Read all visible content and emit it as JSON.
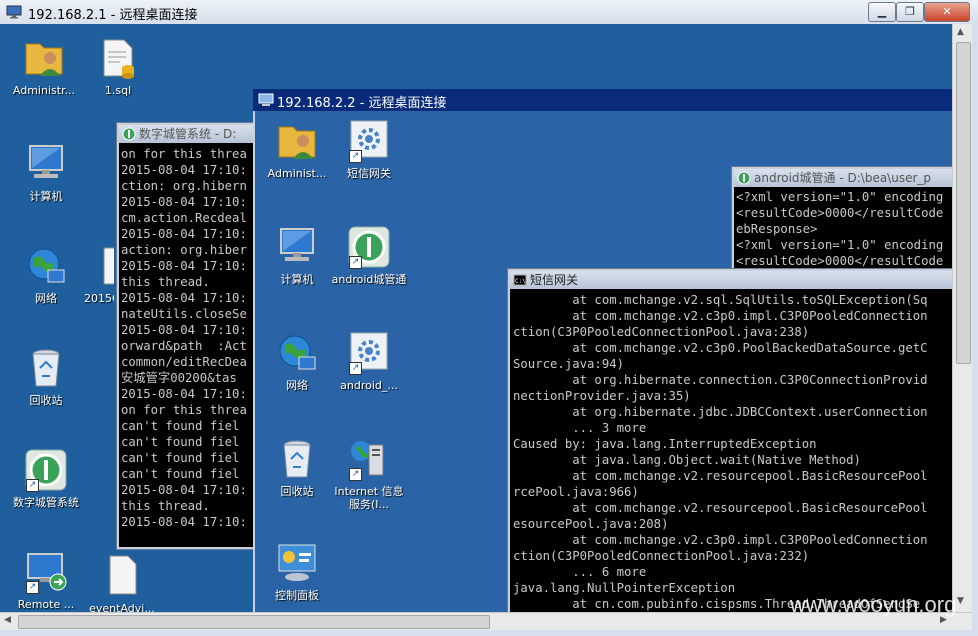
{
  "outer_window": {
    "title": "192.168.2.1 - 远程桌面连接",
    "minimize_label": "▁",
    "restore_label": "❐",
    "close_label": "✕"
  },
  "desktop1_icons": [
    {
      "label": "Administr...",
      "icon": "user-folder-icon"
    },
    {
      "label": "1.sql",
      "icon": "sql-file-icon"
    },
    {
      "label": "计算机",
      "icon": "computer-icon"
    },
    {
      "label": "网络",
      "icon": "network-icon"
    },
    {
      "label": "2015C",
      "icon": "file-icon"
    },
    {
      "label": "回收站",
      "icon": "recycle-bin-icon"
    },
    {
      "label": "数字城管系统",
      "icon": "app-shortcut-icon"
    },
    {
      "label": "Remote ...",
      "icon": "remote-desktop-icon"
    },
    {
      "label": "eventAdvi...",
      "icon": "file-icon"
    }
  ],
  "console_city": {
    "title": "数字城管系统 - D:",
    "lines": [
      "on for this threa",
      "2015-08-04 17:10:",
      "ction: org.hibern",
      "2015-08-04 17:10:",
      "cm.action.Recdeal",
      "2015-08-04 17:10:",
      "action: org.hiber",
      "2015-08-04 17:10:",
      "this thread.",
      "2015-08-04 17:10:",
      "nateUtils.closeSe",
      "2015-08-04 17:10:",
      "orward&path  :Act",
      "common/editRecDea",
      "安城管字00200&tas",
      "2015-08-04 17:10:",
      "on for this threa",
      "can't found fiel",
      "can't found fiel",
      "can't found fiel",
      "can't found fiel",
      "2015-08-04 17:10:",
      "this thread.",
      "2015-08-04 17:10:"
    ]
  },
  "inner_window": {
    "title": "192.168.2.2 - 远程桌面连接"
  },
  "desktop2_icons": [
    {
      "label": "Administ...",
      "icon": "user-folder-icon"
    },
    {
      "label": "短信网关",
      "icon": "gear-shortcut-icon"
    },
    {
      "label": "计算机",
      "icon": "computer-icon"
    },
    {
      "label": "android城管通",
      "icon": "app-shortcut-icon"
    },
    {
      "label": "网络",
      "icon": "network-icon"
    },
    {
      "label": "android_...",
      "icon": "gear-shortcut-icon"
    },
    {
      "label": "回收站",
      "icon": "recycle-bin-icon"
    },
    {
      "label": "Internet 信息服务(I...",
      "icon": "iis-icon"
    },
    {
      "label": "控制面板",
      "icon": "control-panel-icon"
    }
  ],
  "console_android": {
    "title": "android城管通 - D:\\bea\\user_p",
    "lines": [
      "<?xml version=\"1.0\" encoding",
      "<resultCode>0000</resultCode",
      "ebResponse>",
      "<?xml version=\"1.0\" encoding",
      "<resultCode>0000</resultCode"
    ]
  },
  "console_sms": {
    "title": "短信网关",
    "lines": [
      "        at com.mchange.v2.sql.SqlUtils.toSQLException(Sq",
      "        at com.mchange.v2.c3p0.impl.C3P0PooledConnection",
      "ction(C3P0PooledConnectionPool.java:238)",
      "        at com.mchange.v2.c3p0.PoolBackedDataSource.getC",
      "Source.java:94)",
      "        at org.hibernate.connection.C3P0ConnectionProvid",
      "nectionProvider.java:35)",
      "        at org.hibernate.jdbc.JDBCContext.userConnection",
      "        ... 3 more",
      "Caused by: java.lang.InterruptedException",
      "        at java.lang.Object.wait(Native Method)",
      "        at com.mchange.v2.resourcepool.BasicResourcePool",
      "rcePool.java:966)",
      "        at com.mchange.v2.resourcepool.BasicResourcePool",
      "esourcePool.java:208)",
      "        at com.mchange.v2.c3p0.impl.C3P0PooledConnection",
      "ction(C3P0PooledConnectionPool.java:232)",
      "        ... 6 more",
      "java.lang.NullPointerException",
      "        at cn.com.pubinfo.cispsms.Thread.ThreadOfSendSe"
    ]
  },
  "watermark": "www.wooyun.org",
  "colors": {
    "desktop": "#1f5f9e",
    "inner_desktop": "#2a64a6",
    "inner_titlebar": "#0a2b7a",
    "console_bg": "#000000",
    "console_text": "#c8c8c8"
  }
}
